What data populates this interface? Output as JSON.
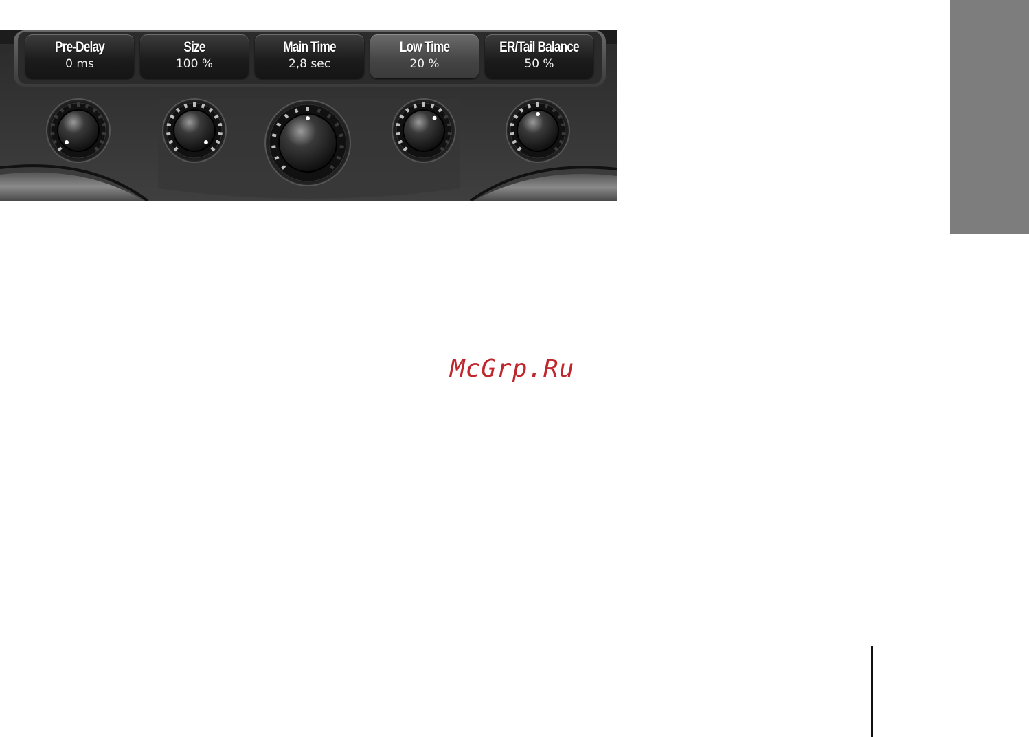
{
  "parameters": [
    {
      "label": "Pre-Delay",
      "value": "0 ms",
      "knob_position": 0.0,
      "active": false
    },
    {
      "label": "Size",
      "value": "100 %",
      "knob_position": 1.0,
      "active": false
    },
    {
      "label": "Main Time",
      "value": "2,8 sec",
      "knob_position": 0.5,
      "active": false
    },
    {
      "label": "Low Time",
      "value": "20 %",
      "knob_position": 0.65,
      "active": true
    },
    {
      "label": "ER/Tail Balance",
      "value": "50 %",
      "knob_position": 0.5,
      "active": false
    }
  ],
  "watermark": "McGrp.Ru",
  "colors": {
    "panel_dark": "#1a1a1a",
    "panel_mid": "#3a3a3a",
    "watermark": "#c0272d",
    "side_tab": "#7d7d7d"
  }
}
